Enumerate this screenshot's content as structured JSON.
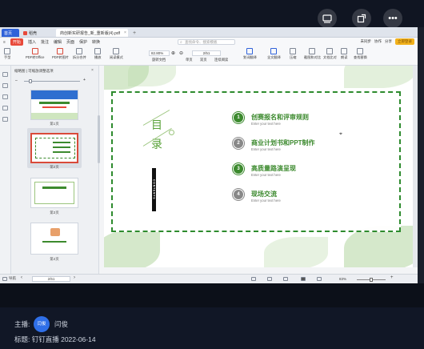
{
  "overlay": {
    "buttons": [
      {
        "icon": "cast-icon"
      },
      {
        "icon": "share-icon"
      },
      {
        "icon": "more-icon",
        "label": "•••"
      }
    ]
  },
  "tabs": [
    {
      "label": "首页",
      "active": false
    },
    {
      "label": "稻壳",
      "active": false
    },
    {
      "label": "商创新实研报告_新_重新版(4).pdf",
      "active": true
    }
  ],
  "menu": {
    "items": [
      "开始",
      "插入",
      "批注",
      "编辑",
      "页面",
      "保护",
      "转换"
    ],
    "search_placeholder": "查找命令、搜索模板",
    "right": [
      "未同步",
      "协作",
      "分享"
    ],
    "promo": "立即登录"
  },
  "toolbar": {
    "items": [
      {
        "label": "手型",
        "icon": "hand-icon"
      },
      {
        "label": "PDF转Office",
        "icon": "pdf-convert-icon"
      },
      {
        "label": "PDF转图片",
        "icon": "pdf-image-icon"
      },
      {
        "label": "拆分合并",
        "icon": "split-merge-icon"
      },
      {
        "label": "播放",
        "icon": "play-icon"
      },
      {
        "label": "阅读模式",
        "icon": "read-mode-icon"
      }
    ],
    "zoom": "82.80%",
    "rotate": "旋转文档",
    "single": "单页",
    "double": "双页",
    "continuous": "连续阅读",
    "page_input": "2/51",
    "right_items": [
      {
        "label": "划词翻译",
        "icon": "translate-icon"
      },
      {
        "label": "全文翻译",
        "icon": "full-translate-icon"
      },
      {
        "label": "压缩",
        "icon": "compress-icon"
      },
      {
        "label": "截图和对比",
        "icon": "screenshot-icon"
      },
      {
        "label": "文档比对",
        "icon": "compare-icon"
      },
      {
        "label": "朗读",
        "icon": "read-aloud-icon"
      },
      {
        "label": "查找替换",
        "icon": "find-replace-icon"
      }
    ]
  },
  "sidebar": {
    "panel_title": "缩略图 | 可缩放调整选项",
    "thumbnails": [
      {
        "label": "第1页",
        "selected": false
      },
      {
        "label": "第2页",
        "selected": true
      },
      {
        "label": "第3页",
        "selected": false
      },
      {
        "label": "第4页",
        "selected": false
      }
    ]
  },
  "slide": {
    "mu": "目",
    "lu": "录",
    "contents": "CONTENTS",
    "items": [
      {
        "num": "1",
        "title": "创赛报名和评审规则",
        "sub": "Enter your text here",
        "style": "g"
      },
      {
        "num": "2",
        "title": "商业计划书和PPT制作",
        "sub": "Enter your text here",
        "style": "gr"
      },
      {
        "num": "3",
        "title": "高质量路演呈现",
        "sub": "Enter your text here",
        "style": "g"
      },
      {
        "num": "4",
        "title": "现场交流",
        "sub": "Enter your text here",
        "style": "gr"
      }
    ]
  },
  "status": {
    "page": "2/51",
    "zoom": "83%",
    "left_label": "导航"
  },
  "footer": {
    "host_label": "主播:",
    "avatar_text": "闫俊",
    "host_name": "闫俊",
    "title": "标题: 钉钉直播 2022-06-14"
  },
  "colors": {
    "accent_green": "#3c8a2e",
    "brand_blue": "#2f62d9",
    "red": "#e8493a"
  }
}
